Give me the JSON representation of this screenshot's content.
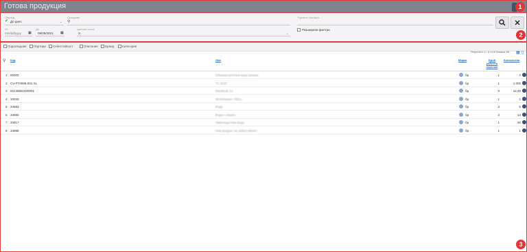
{
  "app": {
    "title": "Готова продукция"
  },
  "badges": [
    "1",
    "2",
    "3"
  ],
  "filters": {
    "period": {
      "label": "Период",
      "value": "До днес"
    },
    "warehouses": {
      "label": "Складове"
    },
    "search_article": {
      "label": "Търсене Артикул"
    },
    "date_from": {
      "label": "От",
      "placeholder": "mm/dd/yyyy"
    },
    "date_to": {
      "label": "До",
      "value": "08/25/2021"
    },
    "price_list": {
      "label": "Ценова листа",
      "value": "X"
    },
    "advanced_filters": {
      "label": "Разширени филтри"
    }
  },
  "column_toggles": [
    "Подскладове",
    "Партиди",
    "Себестойност",
    "Описание",
    "Бранд",
    "Категория"
  ],
  "results_info": "Резултати: 1 - 8 от 8  Покажи: 50",
  "table": {
    "headers": {
      "code": "Код",
      "name": "Име",
      "measure": "Мярка",
      "quantity": "Количество"
    },
    "header_expected": [
      "Брой",
      "работни",
      "поръчки"
    ],
    "rows": [
      {
        "n": "1",
        "code": "00002",
        "name": "Обезмаслителна вода ценник",
        "measure": "бр",
        "orders": "1",
        "qty": "2"
      },
      {
        "n": "2",
        "code": "CV-PT0095-001-XL",
        "name": "T1 2020",
        "measure": "бр",
        "orders": "1",
        "qty": "1 000"
      },
      {
        "n": "3",
        "code": "00140651000001",
        "name": "MacBook 13",
        "measure": "бр",
        "orders": "3",
        "qty": "12,00"
      },
      {
        "n": "4",
        "code": "10033",
        "name": "WorkStation / DELL",
        "measure": "бр",
        "orders": "1",
        "qty": "1"
      },
      {
        "n": "5",
        "code": "34683",
        "name": "Вода",
        "measure": "бр",
        "orders": "3",
        "qty": "6"
      },
      {
        "n": "6",
        "code": "34690",
        "name": "Вода с газина",
        "measure": "бр",
        "orders": "2",
        "qty": "13"
      },
      {
        "n": "7",
        "code": "34917",
        "name": "Лимонадотова вода",
        "measure": "бр",
        "orders": "1",
        "qty": "50"
      },
      {
        "n": "8",
        "code": "34988",
        "name": "Нов продукт за себестойност",
        "measure": "бр",
        "orders": "1",
        "qty": "1"
      }
    ]
  },
  "colors": {
    "titlebar": "#80828f",
    "badge": "#e0363a",
    "link": "#2b6dbd",
    "accent_check": "#2f9e44"
  }
}
